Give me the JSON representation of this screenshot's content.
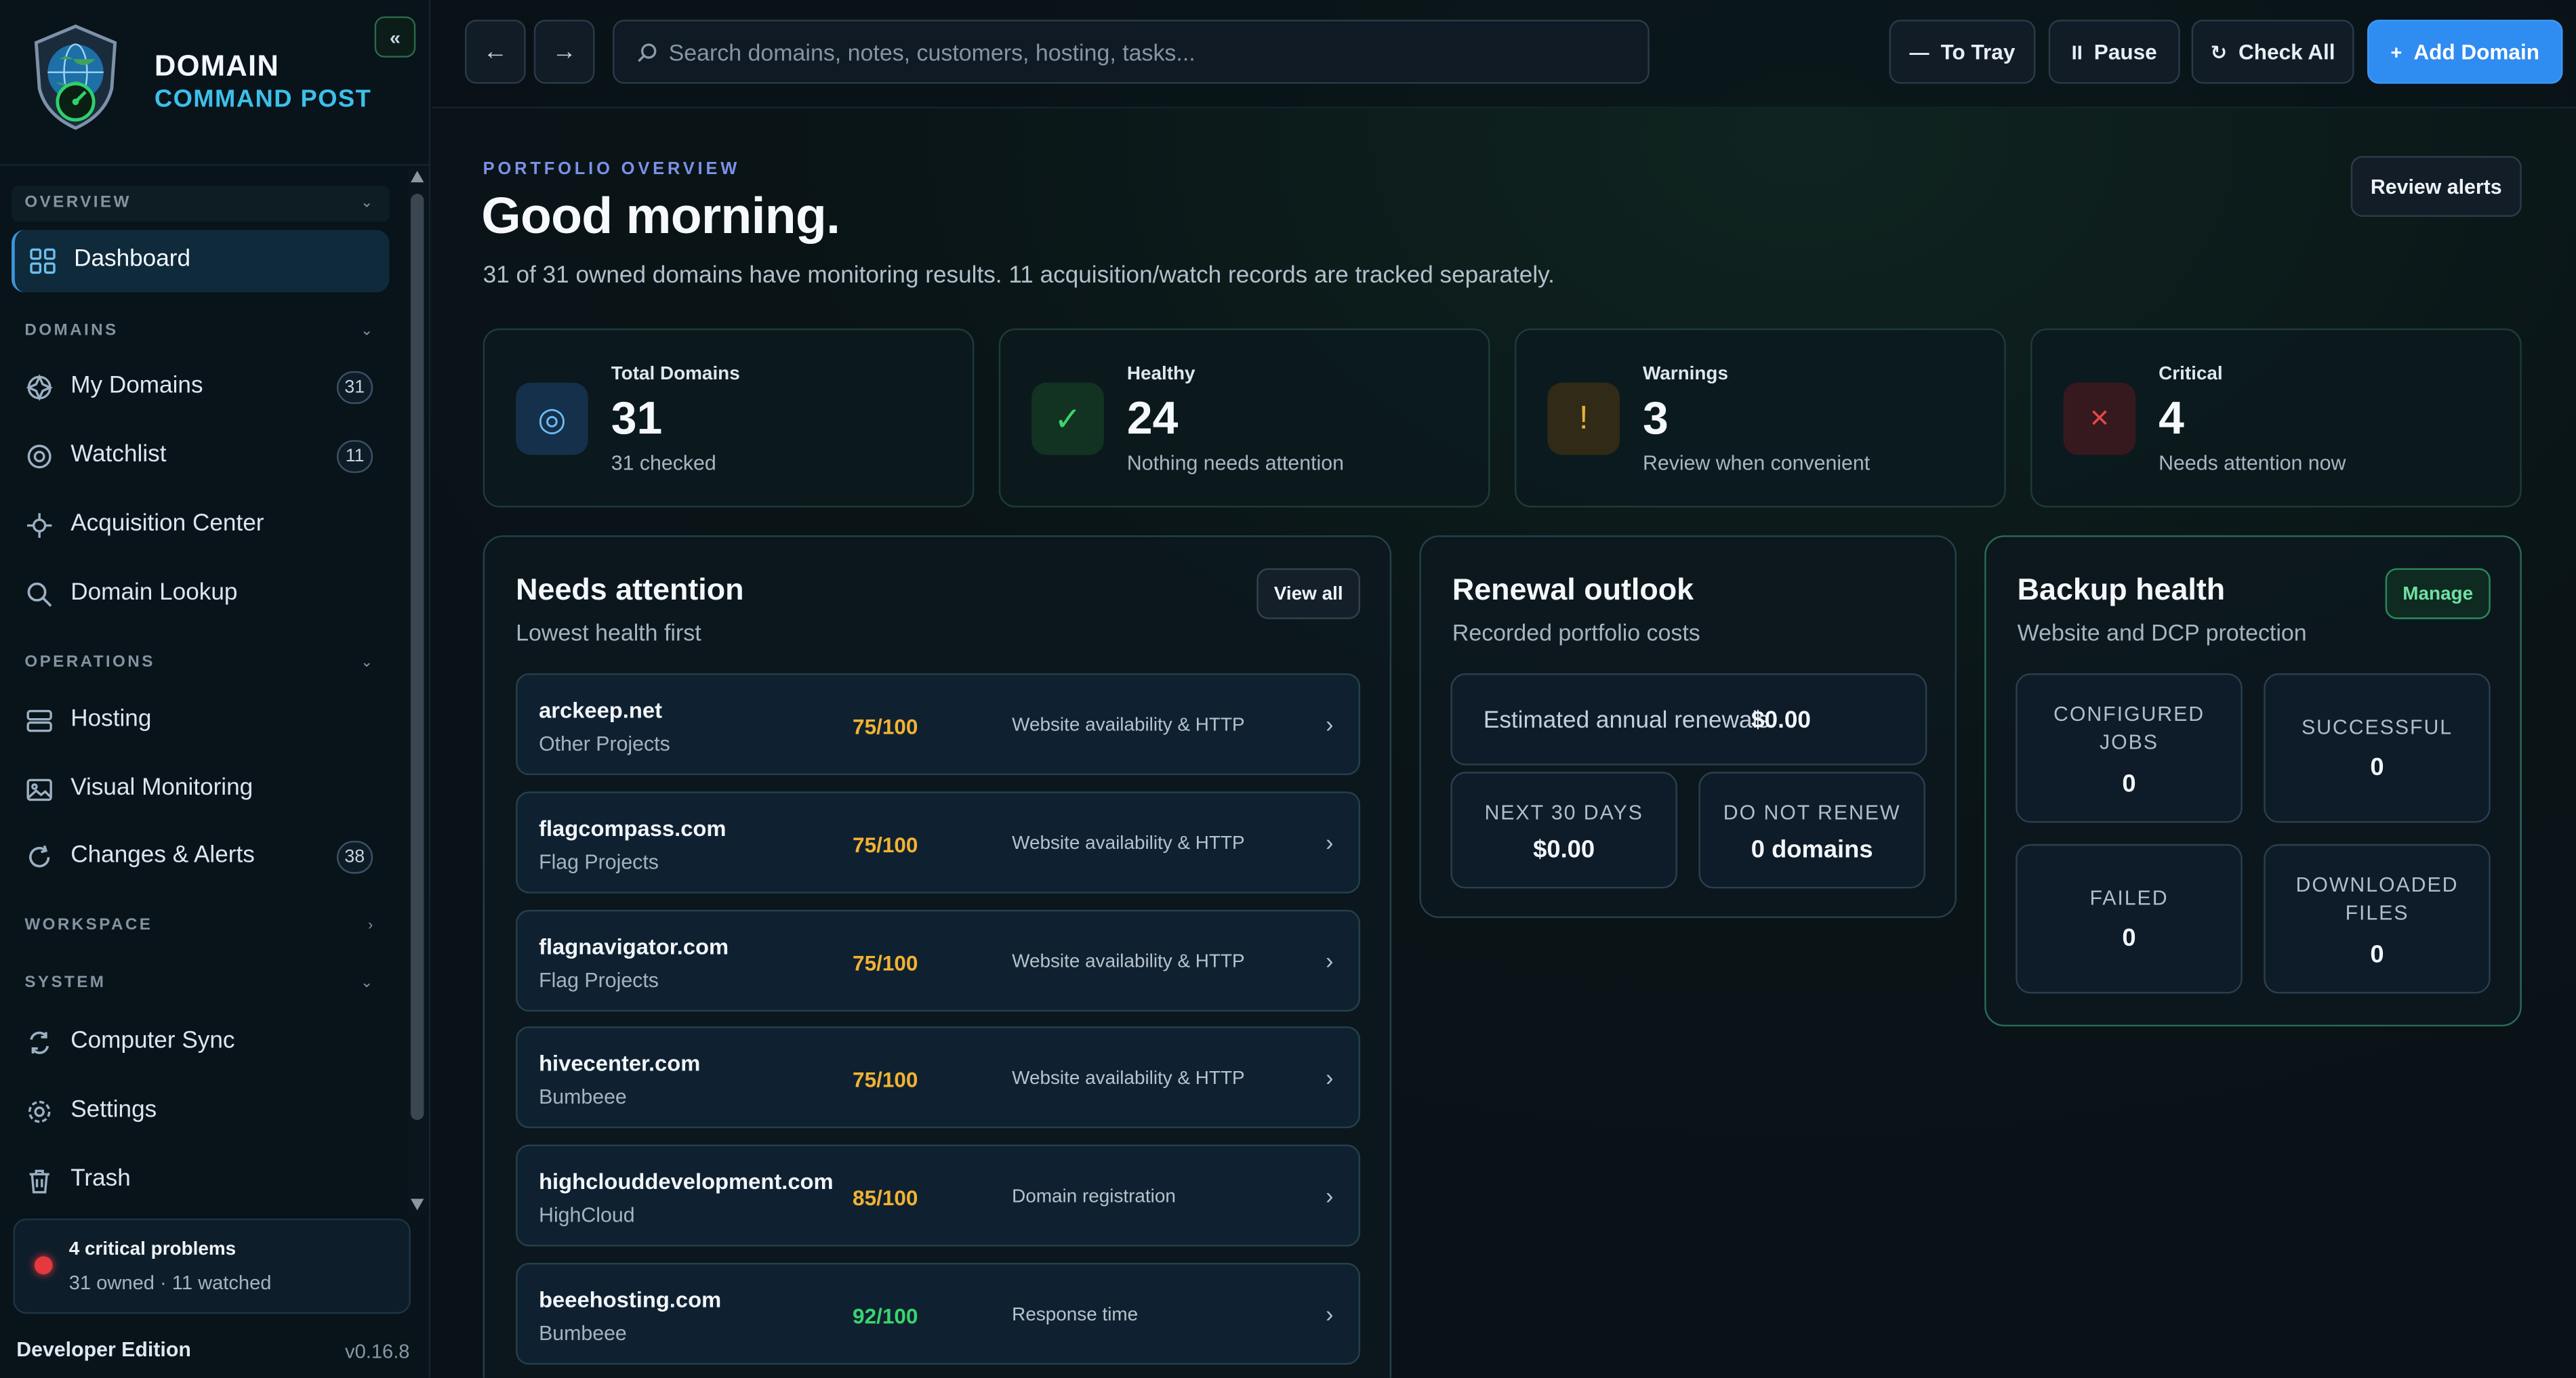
{
  "app": {
    "brand_title": "DOMAIN",
    "brand_subtitle": "COMMAND POST",
    "collapse_label": "«",
    "accent_color": "#2f8cf0",
    "brand_color": "#3cc0ea"
  },
  "sidebar": {
    "sections": {
      "overview": "OVERVIEW",
      "domains": "DOMAINS",
      "operations": "OPERATIONS",
      "workspace": "WORKSPACE",
      "system": "SYSTEM"
    },
    "items": {
      "dashboard": {
        "label": "Dashboard",
        "icon": "grid-icon"
      },
      "my_domains": {
        "label": "My Domains",
        "icon": "globe-icon",
        "count": "31"
      },
      "watchlist": {
        "label": "Watchlist",
        "icon": "eye-icon",
        "count": "11"
      },
      "acquisition": {
        "label": "Acquisition Center",
        "icon": "crosshair-icon"
      },
      "lookup": {
        "label": "Domain Lookup",
        "icon": "search-icon"
      },
      "hosting": {
        "label": "Hosting",
        "icon": "server-icon"
      },
      "visual": {
        "label": "Visual Monitoring",
        "icon": "image-icon"
      },
      "changes": {
        "label": "Changes & Alerts",
        "icon": "refresh-icon",
        "count": "38"
      },
      "sync": {
        "label": "Computer Sync",
        "icon": "sync-icon"
      },
      "settings": {
        "label": "Settings",
        "icon": "gear-icon"
      },
      "trash": {
        "label": "Trash",
        "icon": "trash-icon"
      }
    },
    "critical": {
      "title": "4 critical problems",
      "subtitle": "31 owned · 11 watched"
    },
    "edition": "Developer Edition",
    "version": "v0.16.8"
  },
  "topbar": {
    "search_placeholder": "Search domains, notes, customers, hosting, tasks...",
    "to_tray": "To Tray",
    "pause": "Pause",
    "check_all": "Check All",
    "add_domain": "Add Domain"
  },
  "header": {
    "kicker": "PORTFOLIO OVERVIEW",
    "greeting": "Good morning.",
    "summary": "31 of 31 owned domains have monitoring results. 11 acquisition/watch records are tracked separately.",
    "review_alerts": "Review alerts"
  },
  "stats": {
    "total": {
      "label": "Total Domains",
      "value": "31",
      "sub": "31 checked",
      "color": "#4aa3f0"
    },
    "healthy": {
      "label": "Healthy",
      "value": "24",
      "sub": "Nothing needs attention",
      "color": "#3bd46e"
    },
    "warnings": {
      "label": "Warnings",
      "value": "3",
      "sub": "Review when convenient",
      "color": "#e8b23a"
    },
    "critical": {
      "label": "Critical",
      "value": "4",
      "sub": "Needs attention now",
      "color": "#e5484d"
    }
  },
  "attention": {
    "title": "Needs attention",
    "subtitle": "Lowest health first",
    "view_all": "View all",
    "rows": [
      {
        "domain": "arckeep.net",
        "project": "Other Projects",
        "score": "75/100",
        "reason": "Website availability & HTTP",
        "score_color": "#f2b233"
      },
      {
        "domain": "flagcompass.com",
        "project": "Flag Projects",
        "score": "75/100",
        "reason": "Website availability & HTTP",
        "score_color": "#f2b233"
      },
      {
        "domain": "flagnavigator.com",
        "project": "Flag Projects",
        "score": "75/100",
        "reason": "Website availability & HTTP",
        "score_color": "#f2b233"
      },
      {
        "domain": "hivecenter.com",
        "project": "Bumbeee",
        "score": "75/100",
        "reason": "Website availability & HTTP",
        "score_color": "#f2b233"
      },
      {
        "domain": "highclouddevelopment.com",
        "project": "HighCloud",
        "score": "85/100",
        "reason": "Domain registration",
        "score_color": "#f2b233"
      },
      {
        "domain": "beeehosting.com",
        "project": "Bumbeee",
        "score": "92/100",
        "reason": "Response time",
        "score_color": "#3bd46e"
      }
    ]
  },
  "renewal": {
    "title": "Renewal outlook",
    "subtitle": "Recorded portfolio costs",
    "annual_label": "Estimated annual renewals",
    "annual_value": "$0.00",
    "next30_label": "NEXT 30 DAYS",
    "next30_value": "$0.00",
    "dnr_label": "DO NOT RENEW",
    "dnr_value": "0 domains"
  },
  "backup": {
    "title": "Backup health",
    "subtitle": "Website and DCP protection",
    "manage": "Manage",
    "configured_label": "CONFIGURED JOBS",
    "configured_value": "0",
    "successful_label": "SUCCESSFUL",
    "successful_value": "0",
    "failed_label": "FAILED",
    "failed_value": "0",
    "downloaded_label": "DOWNLOADED FILES",
    "downloaded_value": "0"
  }
}
